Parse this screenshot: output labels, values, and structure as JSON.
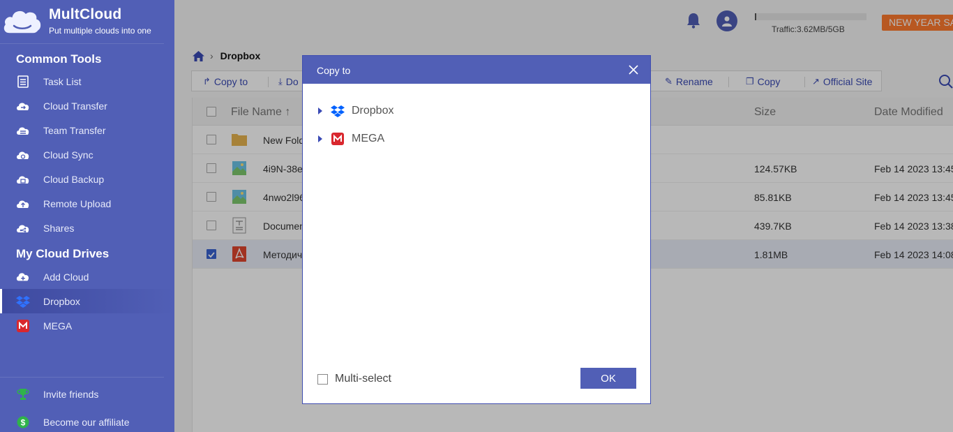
{
  "app": {
    "name": "MultCloud",
    "tagline": "Put multiple clouds into one"
  },
  "sidebar": {
    "common_tools_title": "Common Tools",
    "tools": [
      {
        "label": "Task List",
        "icon": "task-list-icon"
      },
      {
        "label": "Cloud Transfer",
        "icon": "cloud-transfer-icon"
      },
      {
        "label": "Team Transfer",
        "icon": "team-transfer-icon"
      },
      {
        "label": "Cloud Sync",
        "icon": "cloud-sync-icon"
      },
      {
        "label": "Cloud Backup",
        "icon": "cloud-backup-icon"
      },
      {
        "label": "Remote Upload",
        "icon": "remote-upload-icon"
      },
      {
        "label": "Shares",
        "icon": "shares-icon"
      }
    ],
    "drives_title": "My Cloud Drives",
    "drives": [
      {
        "label": "Add Cloud",
        "icon": "add-cloud-icon"
      },
      {
        "label": "Dropbox",
        "icon": "dropbox-icon",
        "active": true
      },
      {
        "label": "MEGA",
        "icon": "mega-icon"
      }
    ],
    "footer": [
      {
        "label": "Invite friends",
        "icon": "trophy-icon"
      },
      {
        "label": "Become our affiliate",
        "icon": "dollar-icon"
      }
    ]
  },
  "header": {
    "traffic": "Traffic:3.62MB/5GB",
    "promo": "NEW YEAR SA"
  },
  "breadcrumb": {
    "current": "Dropbox"
  },
  "toolbar": {
    "copy_to": "Copy to",
    "download": "Do",
    "rename": "Rename",
    "copy": "Copy",
    "official_site": "Official Site"
  },
  "table": {
    "headers": {
      "name": "File Name",
      "size": "Size",
      "date": "Date Modified"
    },
    "rows": [
      {
        "name": "New Fold",
        "size": "",
        "date": "",
        "type": "folder",
        "checked": false
      },
      {
        "name": "4i9N-38e",
        "size": "124.57KB",
        "date": "Feb 14 2023 13:45",
        "type": "image",
        "checked": false
      },
      {
        "name": "4nwo2l96",
        "size": "85.81KB",
        "date": "Feb 14 2023 13:45",
        "type": "image",
        "checked": false
      },
      {
        "name": "Documen",
        "size": "439.7KB",
        "date": "Feb 14 2023 13:38",
        "type": "text",
        "checked": false
      },
      {
        "name": "Методич",
        "size": "1.81MB",
        "date": "Feb 14 2023 14:08",
        "type": "pdf",
        "checked": true
      }
    ]
  },
  "modal": {
    "title": "Copy to",
    "tree": [
      {
        "label": "Dropbox",
        "icon": "dropbox-icon"
      },
      {
        "label": "MEGA",
        "icon": "mega-icon"
      }
    ],
    "multi_select": "Multi-select",
    "ok": "OK"
  },
  "colors": {
    "brand": "#515fb6",
    "promo": "#ff7a2e",
    "dropbox": "#0061fe",
    "mega": "#d9272e"
  }
}
